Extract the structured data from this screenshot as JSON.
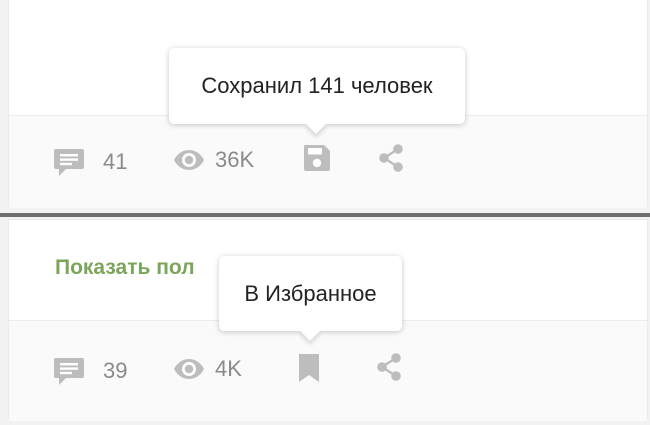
{
  "posts": [
    {
      "comments_count": "41",
      "views_count": "36K",
      "save_state": "saved",
      "tooltip": "Сохранил 141 человек"
    },
    {
      "show_more_label": "Показать пол",
      "comments_count": "39",
      "views_count": "4K",
      "save_state": "not-saved",
      "tooltip": "В Избранное"
    }
  ],
  "icons": {
    "comment": "comment-icon",
    "views": "eye-icon",
    "save_saved": "floppy-disk-icon",
    "save_unsaved": "bookmark-icon",
    "share": "share-icon"
  },
  "colors": {
    "icon": "#bdbdbd",
    "counter_text": "#8a8a8a",
    "show_more": "#7ba65a",
    "tooltip_text": "#222222",
    "divider": "#6e6e6e"
  }
}
